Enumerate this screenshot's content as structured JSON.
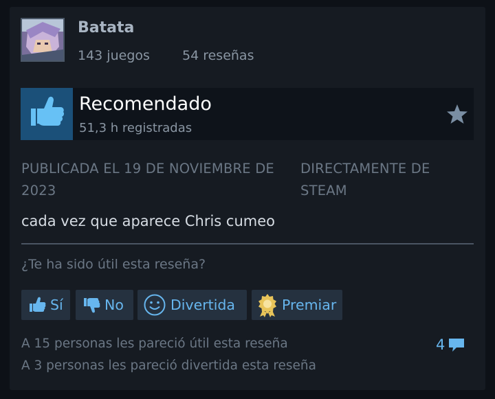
{
  "profile": {
    "username": "Batata",
    "games_label": "143 juegos",
    "reviews_label": "54 reseñas"
  },
  "review": {
    "verdict": "Recomendado",
    "hours": "51,3 h registradas",
    "published": "PUBLICADA EL 19 DE NOVIEMBRE DE 2023",
    "source": "DIRECTAMENTE DE STEAM",
    "text": "cada vez que aparece Chris cumeo"
  },
  "feedback": {
    "question": "¿Te ha sido útil esta reseña?",
    "yes_label": "Sí",
    "no_label": "No",
    "funny_label": "Divertida",
    "award_label": "Premiar",
    "helpful_count_text": "A 15 personas les pareció útil esta reseña",
    "funny_count_text": "A 3 personas les pareció divertida esta reseña",
    "comment_count": "4"
  },
  "colors": {
    "background": "#0d1117",
    "card": "#161b22",
    "accent_blue": "#67b6ee",
    "thumb_tile": "#1b5079",
    "button_bg": "#25313f",
    "award_gold": "#e8c45a"
  },
  "icons": {
    "thumb": "thumbs-up-icon",
    "star": "star-icon",
    "yes": "thumbs-up-icon",
    "no": "thumbs-down-icon",
    "funny": "smiley-icon",
    "award": "award-medal-icon",
    "comments": "speech-bubble-icon"
  }
}
